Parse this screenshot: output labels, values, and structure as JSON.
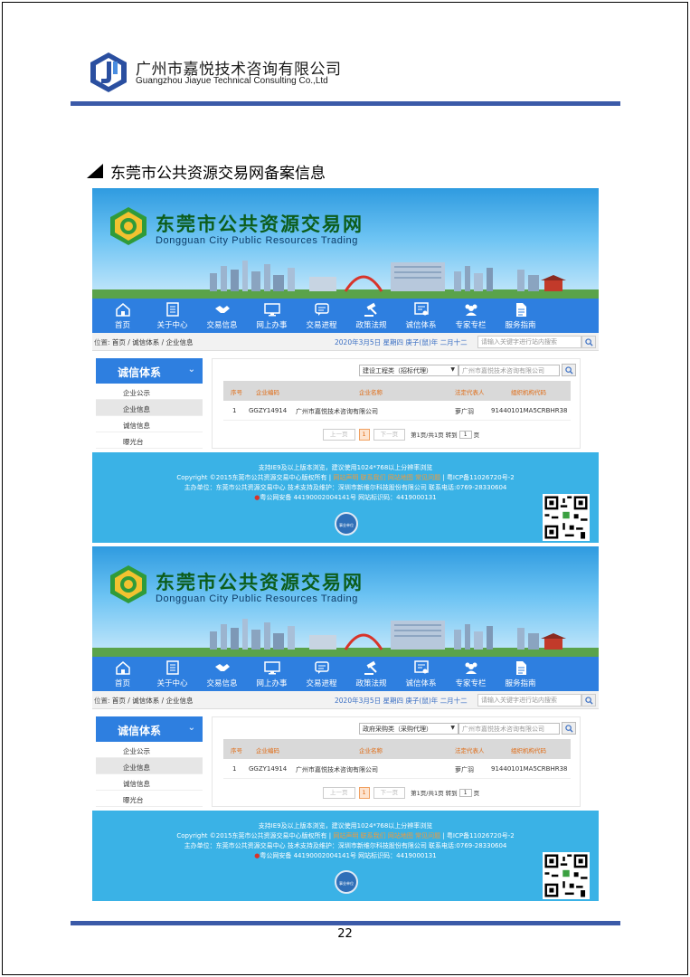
{
  "company": {
    "name_cn": "广州市嘉悦技术咨询有限公司",
    "name_en": "Guangzhou Jiayue Technical Consulting Co.,Ltd"
  },
  "section_title": "东莞市公共资源交易网备案信息",
  "colors": {
    "brand_blue": "#3b5aa8",
    "nav_blue": "#2e7fe0",
    "footer_blue": "#3ab2e6",
    "accent_orange": "#e06a12"
  },
  "site": {
    "name_cn": "东莞市公共资源交易网",
    "name_en": "Dongguan City Public Resources Trading",
    "nav": [
      {
        "label": "首页",
        "icon": "home-icon"
      },
      {
        "label": "关于中心",
        "icon": "document-icon"
      },
      {
        "label": "交易信息",
        "icon": "handshake-icon"
      },
      {
        "label": "网上办事",
        "icon": "monitor-icon"
      },
      {
        "label": "交易进程",
        "icon": "chat-icon"
      },
      {
        "label": "政策法规",
        "icon": "gavel-icon"
      },
      {
        "label": "诚信体系",
        "icon": "certificate-icon"
      },
      {
        "label": "专家专栏",
        "icon": "group-icon"
      },
      {
        "label": "服务指南",
        "icon": "file-icon"
      }
    ],
    "breadcrumb": {
      "prefix": "位置:",
      "path": "首页 / 诚信体系 / 企业信息"
    },
    "date": "2020年3月5日 星期四 庚子(鼠)年 二月十二",
    "search_placeholder": "请输入关键字进行站内搜索",
    "sidebar": {
      "title": "诚信体系",
      "items": [
        "企业公示",
        "企业信息",
        "诚信信息",
        "曝光台"
      ],
      "active_index": 1
    },
    "table": {
      "columns": [
        "序号",
        "企业编码",
        "企业名称",
        "法定代表人",
        "组织机构代码"
      ],
      "row": [
        "1",
        "GGZY14914",
        "广州市嘉悦技术咨询有限公司",
        "萝广羽",
        "91440101MA5CRBHR38"
      ]
    },
    "pager": {
      "prev": "上一页",
      "current": "1",
      "next": "下一页",
      "summary": "第1页/共1页 转到",
      "goto_value": "1",
      "page_unit": "页"
    },
    "enterprise_search_placeholder": "广州市嘉悦技术咨询有限公司",
    "footer": {
      "line1": "支持IE9及以上版本浏览，建议使用1024*768以上分辨率浏览",
      "line2_prefix": "Copyright ©2015东莞市公共资源交易中心版权所有 |",
      "line2_links": [
        "网站声明",
        "联系我们",
        "网站地图",
        "常见问题"
      ],
      "line2_suffix": "| 粤ICP备11026720号-2",
      "line3": "主办单位：东莞市公共资源交易中心 技术支持及维护：深圳市新维尔科技股份有限公司  联系电话:0769-28330604",
      "line4": "粤公网安备 44190002004141号 网站标识码：4419000131",
      "badge_text": "事业单位"
    }
  },
  "shots": [
    {
      "filter": "建设工程类（招标代理）"
    },
    {
      "filter": "政府采购类（采购代理）"
    }
  ],
  "page_number": "22"
}
